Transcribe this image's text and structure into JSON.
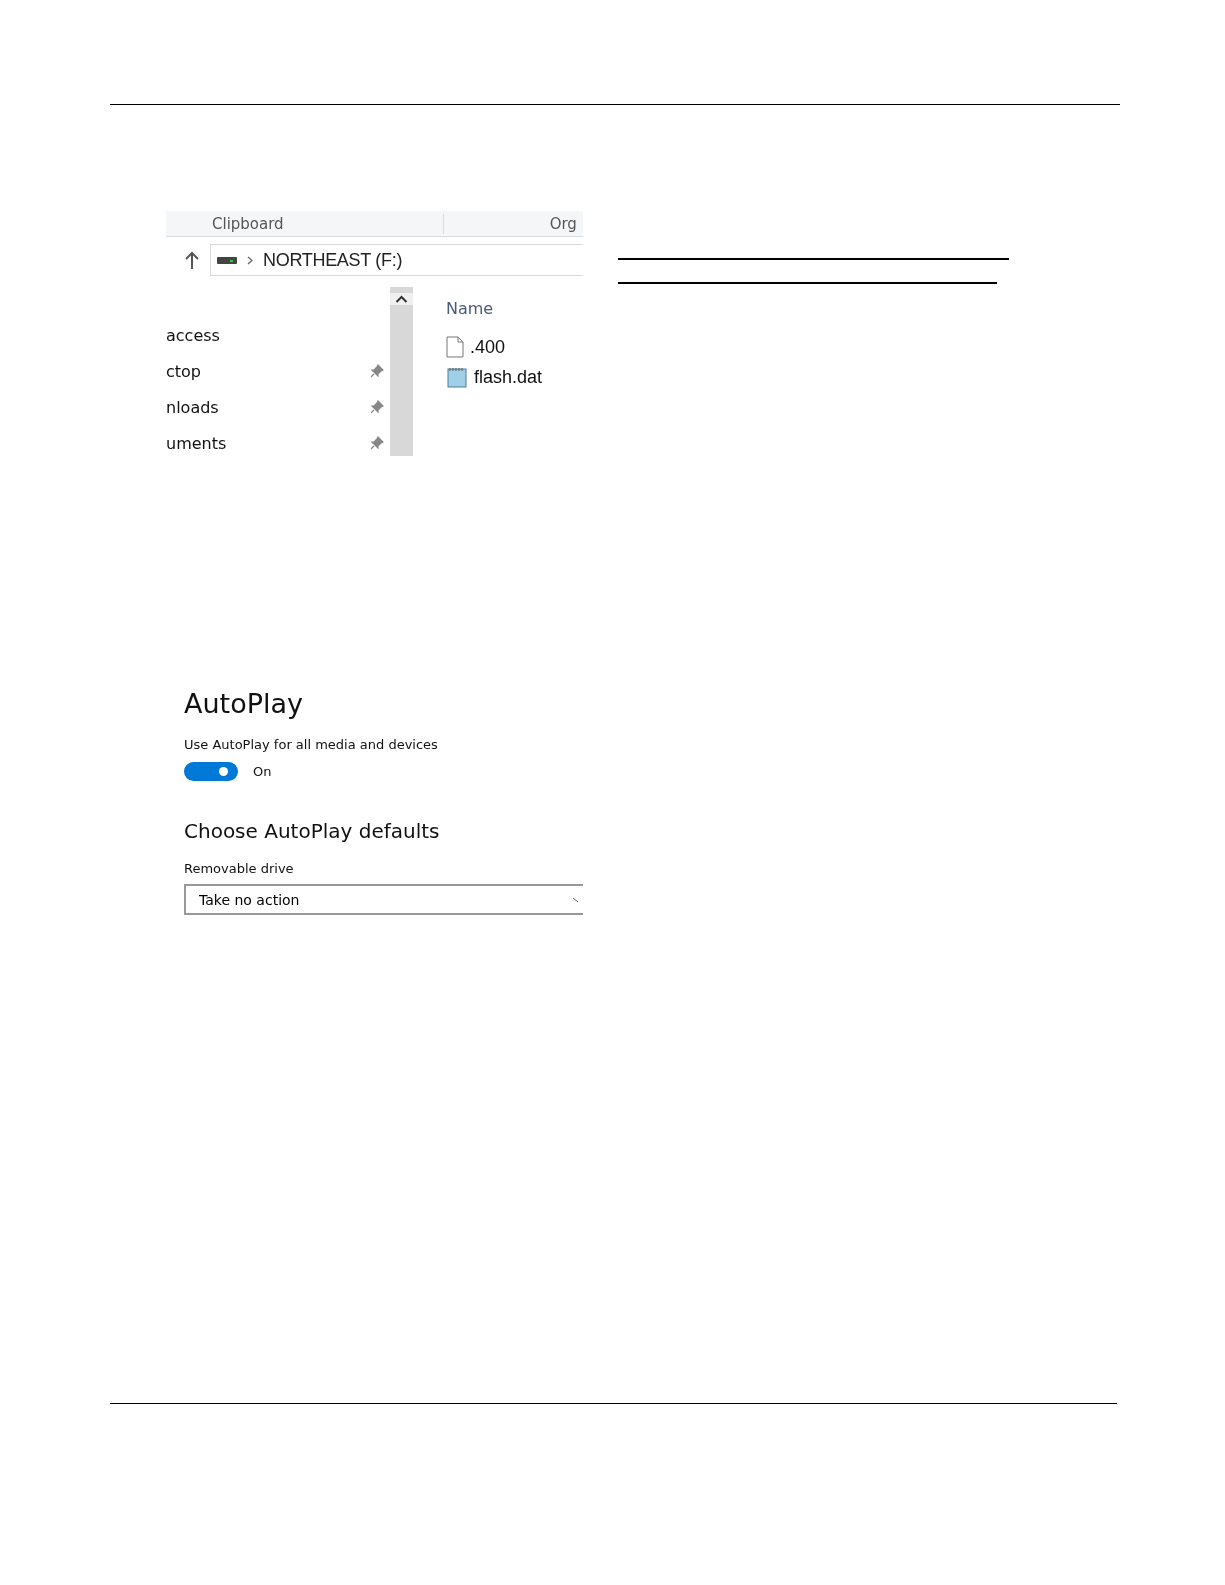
{
  "explorer": {
    "ribbon_groups": [
      "Clipboard",
      "Org"
    ],
    "address": "NORTHEAST (F:)",
    "nav_items": [
      {
        "label": "access",
        "pinned": false
      },
      {
        "label": "ctop",
        "pinned": true
      },
      {
        "label": "nloads",
        "pinned": true
      },
      {
        "label": "uments",
        "pinned": true
      }
    ],
    "column_header": "Name",
    "files": [
      {
        "name": ".400",
        "kind": "blank"
      },
      {
        "name": "flash.dat",
        "kind": "notepad"
      }
    ]
  },
  "fill_in_lines": [
    {
      "kind": "long"
    },
    {
      "kind": "short"
    }
  ],
  "autoplay": {
    "title": "AutoPlay",
    "toggle_label": "Use AutoPlay for all media and devices",
    "toggle": {
      "on": true,
      "state_label": "On"
    },
    "defaults_heading": "Choose AutoPlay defaults",
    "dropdown_label": "Removable drive",
    "dropdown_value": "Take no action"
  }
}
